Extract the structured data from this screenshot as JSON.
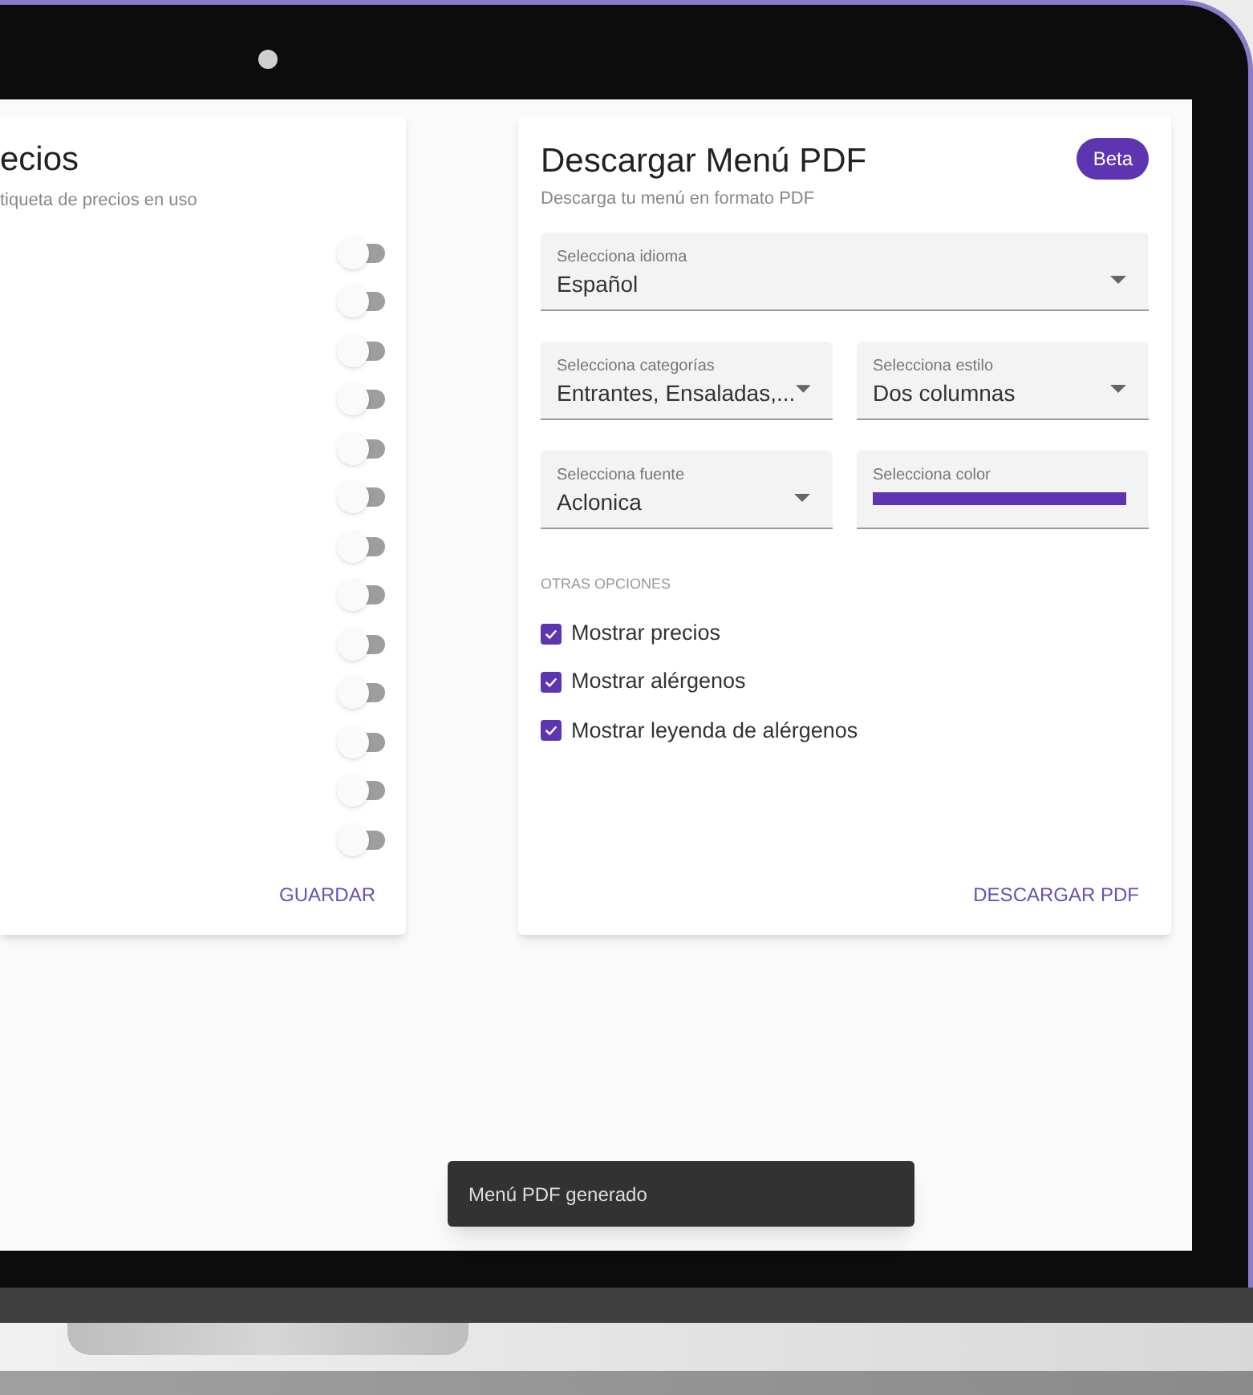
{
  "prices_card": {
    "title": "ecios",
    "subtitle": "tiqueta de precios en uso",
    "toggles": [
      {
        "on": false
      },
      {
        "on": false
      },
      {
        "on": false
      },
      {
        "on": false
      },
      {
        "on": false
      },
      {
        "on": false
      },
      {
        "on": false
      },
      {
        "on": false
      },
      {
        "on": false
      },
      {
        "on": false
      },
      {
        "on": false
      },
      {
        "on": false
      },
      {
        "on": false
      }
    ],
    "button": "GUARDAR"
  },
  "pdf_card": {
    "title": "Descargar Menú PDF",
    "badge": "Beta",
    "subtitle": "Descarga tu menú en formato PDF",
    "field_rows": [
      [
        {
          "kind": "select",
          "label": "Selecciona idioma",
          "value": "Español"
        }
      ],
      [
        {
          "kind": "select",
          "label": "Selecciona categorías",
          "value": "Entrantes, Ensaladas,..."
        },
        {
          "kind": "select",
          "label": "Selecciona estilo",
          "value": "Dos columnas"
        }
      ],
      [
        {
          "kind": "select",
          "label": "Selecciona fuente",
          "value": "Aclonica"
        },
        {
          "kind": "color",
          "label": "Selecciona color",
          "color": "#5e35b1"
        }
      ]
    ],
    "section": "OTRAS OPCIONES",
    "options": [
      {
        "label": "Mostrar precios",
        "checked": true
      },
      {
        "label": "Mostrar alérgenos",
        "checked": true
      },
      {
        "label": "Mostrar leyenda de alérgenos",
        "checked": true
      }
    ],
    "button": "DESCARGAR PDF"
  },
  "toast": "Menú PDF generado"
}
